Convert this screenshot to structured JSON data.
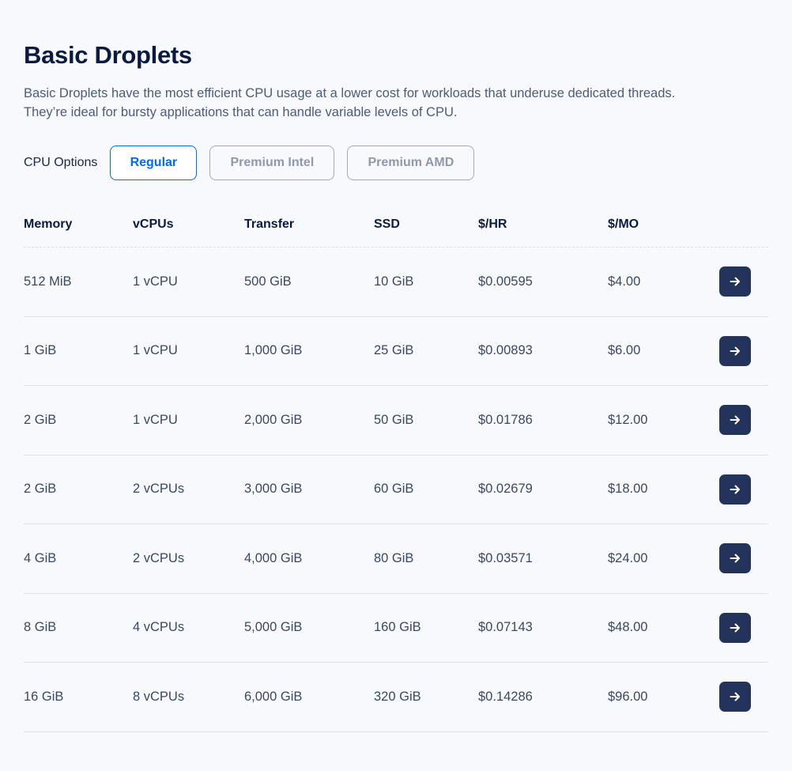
{
  "header": {
    "title": "Basic Droplets",
    "description_line1": "Basic Droplets have the most efficient CPU usage at a lower cost for workloads that underuse dedicated threads.",
    "description_line2": "They’re ideal for bursty applications that can handle variable levels of CPU."
  },
  "cpu_options": {
    "label": "CPU Options",
    "options": [
      {
        "label": "Regular",
        "selected": true
      },
      {
        "label": "Premium Intel",
        "selected": false
      },
      {
        "label": "Premium AMD",
        "selected": false
      }
    ]
  },
  "table": {
    "columns": [
      "Memory",
      "vCPUs",
      "Transfer",
      "SSD",
      "$/HR",
      "$/MO"
    ],
    "rows": [
      [
        "512 MiB",
        "1 vCPU",
        "500 GiB",
        "10 GiB",
        "$0.00595",
        "$4.00"
      ],
      [
        "1 GiB",
        "1 vCPU",
        "1,000 GiB",
        "25 GiB",
        "$0.00893",
        "$6.00"
      ],
      [
        "2 GiB",
        "1 vCPU",
        "2,000 GiB",
        "50 GiB",
        "$0.01786",
        "$12.00"
      ],
      [
        "2 GiB",
        "2 vCPUs",
        "3,000 GiB",
        "60 GiB",
        "$0.02679",
        "$18.00"
      ],
      [
        "4 GiB",
        "2 vCPUs",
        "4,000 GiB",
        "80 GiB",
        "$0.03571",
        "$24.00"
      ],
      [
        "8 GiB",
        "4 vCPUs",
        "5,000 GiB",
        "160 GiB",
        "$0.07143",
        "$48.00"
      ],
      [
        "16 GiB",
        "8 vCPUs",
        "6,000 GiB",
        "320 GiB",
        "$0.14286",
        "$96.00"
      ]
    ],
    "row_action_icon": "arrow-right-icon"
  },
  "colors": {
    "accent": "#0069ff",
    "title": "#0b1b40",
    "button_dark": "#23335c",
    "background": "#f7f9fc"
  }
}
